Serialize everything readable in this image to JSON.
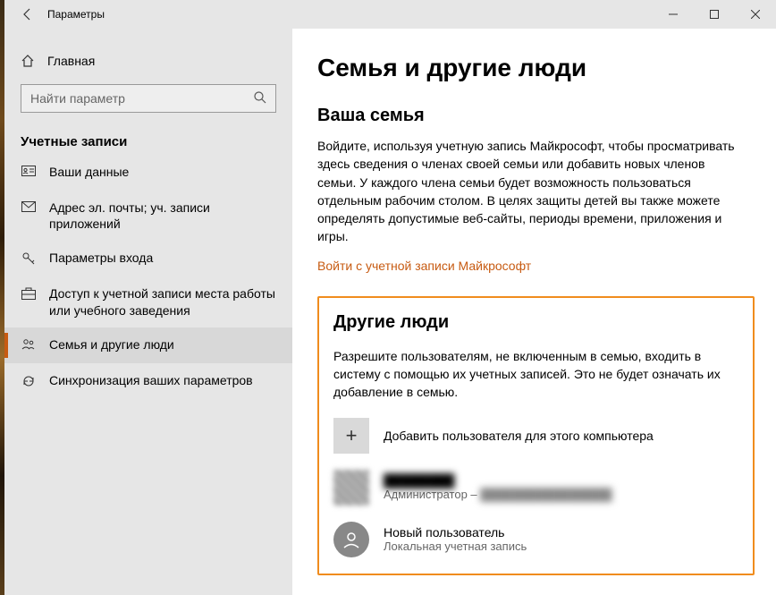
{
  "window": {
    "title": "Параметры"
  },
  "sidebar": {
    "home": "Главная",
    "search_placeholder": "Найти параметр",
    "section": "Учетные записи",
    "items": [
      {
        "label": "Ваши данные"
      },
      {
        "label": "Адрес эл. почты; уч. записи приложений"
      },
      {
        "label": "Параметры входа"
      },
      {
        "label": "Доступ к учетной записи места работы или учебного заведения"
      },
      {
        "label": "Семья и другие люди"
      },
      {
        "label": "Синхронизация ваших параметров"
      }
    ]
  },
  "content": {
    "page_title": "Семья и другие люди",
    "family": {
      "heading": "Ваша семья",
      "body": "Войдите, используя учетную запись Майкрософт, чтобы просматривать здесь сведения о членах своей семьи или добавить новых членов семьи. У каждого члена семьи будет возможность пользоваться отдельным рабочим столом. В целях защиты детей вы также можете определять допустимые веб-сайты, периоды времени, приложения и игры.",
      "link": "Войти с учетной записи Майкрософт"
    },
    "others": {
      "heading": "Другие люди",
      "body": "Разрешите пользователям, не включенным в семью, входить в систему с помощью их учетных записей. Это не будет означать их добавление в семью.",
      "add_label": "Добавить пользователя для этого компьютера",
      "users": [
        {
          "name": "████████",
          "sub_prefix": "Администратор – ",
          "sub_blur": "████████████████"
        },
        {
          "name": "Новый пользователь",
          "sub": "Локальная учетная запись"
        }
      ]
    }
  }
}
